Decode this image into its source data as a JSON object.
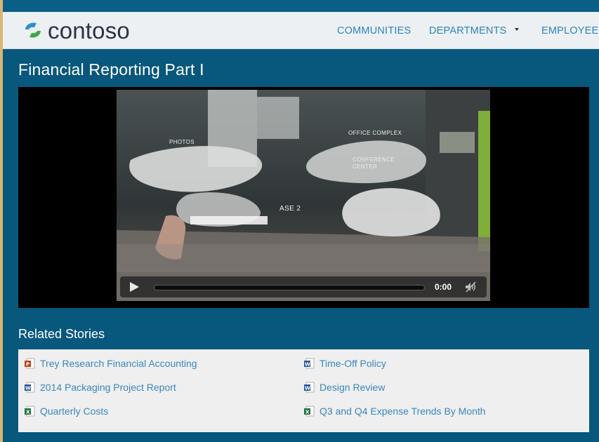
{
  "header": {
    "logo_text": "contoso",
    "nav": [
      {
        "label": "COMMUNITIES"
      },
      {
        "label": "DEPARTMENTS"
      },
      {
        "label": "EMPLOYEE"
      }
    ]
  },
  "page": {
    "title": "Financial Reporting Part I"
  },
  "video": {
    "scene_labels": [
      "PHOTOS",
      "OFFICE COMPLEX",
      "CONFERENCE",
      "CENTER",
      "ASE 2"
    ],
    "time": "0:00",
    "progress": 0
  },
  "related": {
    "heading": "Related Stories",
    "items": [
      {
        "label": "Trey Research Financial Accounting",
        "icon": "powerpoint-file-icon"
      },
      {
        "label": "2014 Packaging Project Report",
        "icon": "word-file-icon"
      },
      {
        "label": "Quarterly Costs",
        "icon": "excel-file-icon"
      },
      {
        "label": "Time-Off Policy",
        "icon": "word-file-icon"
      },
      {
        "label": "Design Review",
        "icon": "word-file-icon"
      },
      {
        "label": "Q3 and Q4 Expense Trends By Month",
        "icon": "excel-file-icon"
      }
    ]
  },
  "colors": {
    "page_bg": "#08577d",
    "header_bg": "#edf0f2",
    "nav_link": "#2a84c0",
    "story_link": "#3a86bf",
    "powerpoint": "#c43e1c",
    "word": "#2b579a",
    "excel": "#217346"
  }
}
